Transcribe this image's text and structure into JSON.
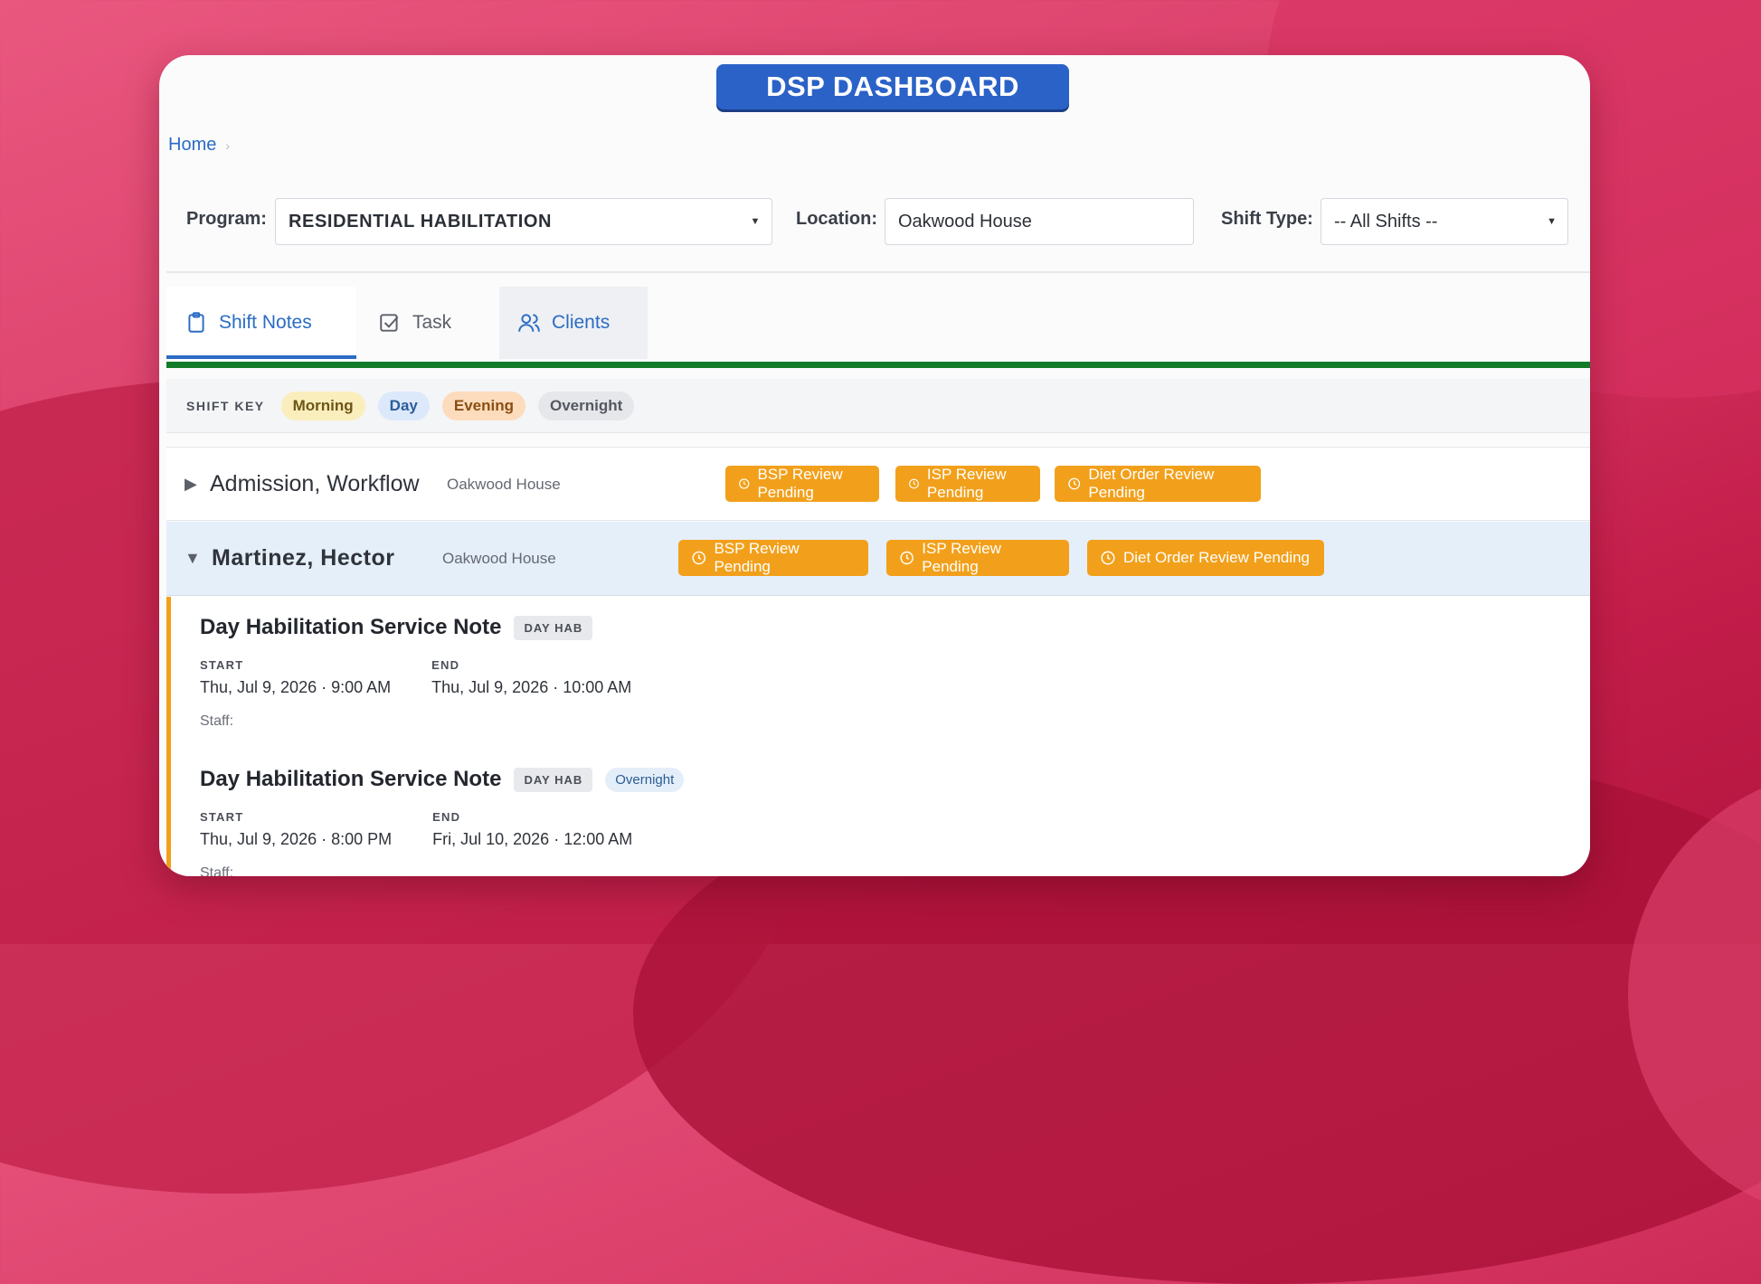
{
  "banner": {
    "title": "DSP DASHBOARD"
  },
  "breadcrumb": {
    "home": "Home",
    "separator": "›"
  },
  "filters": {
    "program_label": "Program:",
    "program_value": "RESIDENTIAL HABILITATION",
    "location_label": "Location:",
    "location_value": "Oakwood House",
    "shift_label": "Shift Type:",
    "shift_value": "-- All Shifts --"
  },
  "tabs": [
    {
      "label": "Shift Notes",
      "icon": "clipboard-icon",
      "state": "active"
    },
    {
      "label": "Task",
      "icon": "checkbox-icon",
      "state": "normal"
    },
    {
      "label": "Clients",
      "icon": "users-icon",
      "state": "hover"
    }
  ],
  "shift_key": {
    "label": "SHIFT KEY",
    "items": [
      "Morning",
      "Day",
      "Evening",
      "Overnight"
    ]
  },
  "clients": [
    {
      "name": "Admission, Workflow",
      "location": "Oakwood House",
      "expanded": false,
      "toggle": "▶",
      "badges": [
        "BSP Review Pending",
        "ISP Review Pending",
        "Diet Order Review Pending"
      ]
    },
    {
      "name": "Martinez, Hector",
      "location": "Oakwood House",
      "expanded": true,
      "toggle": "▼",
      "badges": [
        "BSP Review Pending",
        "ISP Review Pending",
        "Diet Order Review Pending"
      ]
    }
  ],
  "notes": [
    {
      "title": "Day Habilitation Service Note",
      "tag": "DAY HAB",
      "shift": "",
      "start_label": "START",
      "start": "Thu, Jul 9, 2026 · 9:00 AM",
      "end_label": "END",
      "end": "Thu, Jul 9, 2026 · 10:00 AM",
      "staff_label": "Staff:"
    },
    {
      "title": "Day Habilitation Service Note",
      "tag": "DAY HAB",
      "shift": "Overnight",
      "start_label": "START",
      "start": "Thu, Jul 9, 2026 · 8:00 PM",
      "end_label": "END",
      "end": "Fri, Jul 10, 2026 · 12:00 AM",
      "staff_label": "Staff:"
    }
  ],
  "colors": {
    "accent_blue": "#2b6cc4",
    "banner_blue": "#2b62c7",
    "green_bar": "#127b27",
    "badge_orange": "#f2a01b",
    "background_pink": "#d83a66"
  }
}
